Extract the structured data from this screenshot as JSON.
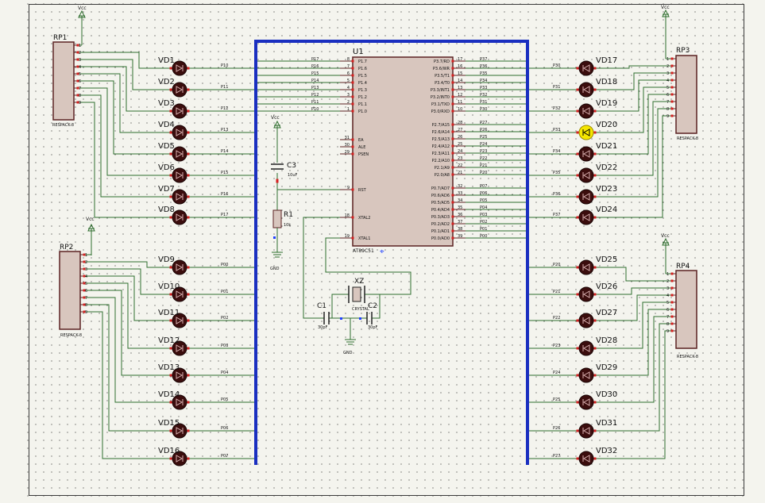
{
  "sheet": {
    "background": "#f4f4ee",
    "grid_color": "#1a1a1a",
    "border_color": "#3a3a3a",
    "wire_color": "#2e6e2e",
    "bus_color": "#1a2fc0",
    "chip_fill": "#d8c6be",
    "chip_border": "#5b2222",
    "led_off_color": "#3b0d0d",
    "led_on_color": "#f5e600",
    "pin_dot_color": "#d62020",
    "blue_marker_color": "#2040ff"
  },
  "labels": {
    "vcc": "Vcc",
    "gnd": "GND",
    "resistor_pack_value": "RESPACK-8"
  },
  "resistor_packs": [
    {
      "ref": "RP1",
      "pins": [
        "1",
        "2",
        "3",
        "4",
        "5",
        "6",
        "7",
        "8",
        "9"
      ]
    },
    {
      "ref": "RP2",
      "pins": [
        "1",
        "2",
        "3",
        "4",
        "5",
        "6",
        "7",
        "8",
        "9"
      ]
    },
    {
      "ref": "RP3",
      "pins": [
        "1",
        "2",
        "3",
        "4",
        "5",
        "6",
        "7",
        "8",
        "9"
      ]
    },
    {
      "ref": "RP4",
      "pins": [
        "1",
        "2",
        "3",
        "4",
        "5",
        "6",
        "7",
        "8",
        "9"
      ]
    }
  ],
  "leds_left": [
    {
      "ref": "VD1",
      "net": "P10"
    },
    {
      "ref": "VD2",
      "net": "P11"
    },
    {
      "ref": "VD3",
      "net": "P12"
    },
    {
      "ref": "VD4",
      "net": "P13"
    },
    {
      "ref": "VD5",
      "net": "P14"
    },
    {
      "ref": "VD6",
      "net": "P15"
    },
    {
      "ref": "VD7",
      "net": "P16"
    },
    {
      "ref": "VD8",
      "net": "P17"
    },
    {
      "ref": "VD9",
      "net": "P00"
    },
    {
      "ref": "VD10",
      "net": "P01"
    },
    {
      "ref": "VD11",
      "net": "P02"
    },
    {
      "ref": "VD12",
      "net": "P03"
    },
    {
      "ref": "VD13",
      "net": "P04"
    },
    {
      "ref": "VD14",
      "net": "P05"
    },
    {
      "ref": "VD15",
      "net": "P06"
    },
    {
      "ref": "VD16",
      "net": "P07"
    }
  ],
  "leds_right": [
    {
      "ref": "VD17",
      "net": "P30",
      "lit": false
    },
    {
      "ref": "VD18",
      "net": "P31",
      "lit": false
    },
    {
      "ref": "VD19",
      "net": "P32",
      "lit": false
    },
    {
      "ref": "VD20",
      "net": "P33",
      "lit": true
    },
    {
      "ref": "VD21",
      "net": "P34",
      "lit": false
    },
    {
      "ref": "VD22",
      "net": "P35",
      "lit": false
    },
    {
      "ref": "VD23",
      "net": "P36",
      "lit": false
    },
    {
      "ref": "VD24",
      "net": "P37",
      "lit": false
    },
    {
      "ref": "VD25",
      "net": "P20",
      "lit": false
    },
    {
      "ref": "VD26",
      "net": "P21",
      "lit": false
    },
    {
      "ref": "VD27",
      "net": "P22",
      "lit": false
    },
    {
      "ref": "VD28",
      "net": "P23",
      "lit": false
    },
    {
      "ref": "VD29",
      "net": "P24",
      "lit": false
    },
    {
      "ref": "VD30",
      "net": "P25",
      "lit": false
    },
    {
      "ref": "VD31",
      "net": "P26",
      "lit": false
    },
    {
      "ref": "VD32",
      "net": "P27",
      "lit": false
    }
  ],
  "mcu": {
    "ref": "U1",
    "part": "AT89C51",
    "left_pins": [
      {
        "num": "8",
        "name": "P1.7",
        "net": "P17"
      },
      {
        "num": "7",
        "name": "P1.6",
        "net": "P16"
      },
      {
        "num": "6",
        "name": "P1.5",
        "net": "P15"
      },
      {
        "num": "5",
        "name": "P1.4",
        "net": "P14"
      },
      {
        "num": "4",
        "name": "P1.3",
        "net": "P13"
      },
      {
        "num": "3",
        "name": "P1.2",
        "net": "P12"
      },
      {
        "num": "2",
        "name": "P1.1",
        "net": "P11"
      },
      {
        "num": "1",
        "name": "P1.0",
        "net": "P10"
      },
      {
        "num": "31",
        "name": "EA",
        "net": ""
      },
      {
        "num": "30",
        "name": "ALE",
        "net": ""
      },
      {
        "num": "29",
        "name": "PSEN",
        "net": ""
      },
      {
        "num": "9",
        "name": "RST",
        "net": ""
      },
      {
        "num": "18",
        "name": "XTAL2",
        "net": ""
      },
      {
        "num": "19",
        "name": "XTAL1",
        "net": ""
      }
    ],
    "right_pins": [
      {
        "num": "17",
        "name": "P3.7/RD",
        "net": "P37"
      },
      {
        "num": "16",
        "name": "P3.6/WR",
        "net": "P36"
      },
      {
        "num": "15",
        "name": "P3.5/T1",
        "net": "P35"
      },
      {
        "num": "14",
        "name": "P3.4/T0",
        "net": "P34"
      },
      {
        "num": "13",
        "name": "P3.3/INT1",
        "net": "P33"
      },
      {
        "num": "12",
        "name": "P3.2/INT0",
        "net": "P32"
      },
      {
        "num": "11",
        "name": "P3.1/TXD",
        "net": "P31"
      },
      {
        "num": "10",
        "name": "P3.0/RXD",
        "net": "P30"
      },
      {
        "num": "28",
        "name": "P2.7/A15",
        "net": "P27"
      },
      {
        "num": "27",
        "name": "P2.6/A14",
        "net": "P26"
      },
      {
        "num": "26",
        "name": "P2.5/A13",
        "net": "P25"
      },
      {
        "num": "25",
        "name": "P2.4/A12",
        "net": "P24"
      },
      {
        "num": "24",
        "name": "P2.3/A11",
        "net": "P23"
      },
      {
        "num": "23",
        "name": "P2.2/A10",
        "net": "P22"
      },
      {
        "num": "22",
        "name": "P2.1/A9",
        "net": "P21"
      },
      {
        "num": "21",
        "name": "P2.0/A8",
        "net": "P20"
      },
      {
        "num": "32",
        "name": "P0.7/AD7",
        "net": "P07"
      },
      {
        "num": "33",
        "name": "P0.6/AD6",
        "net": "P06"
      },
      {
        "num": "34",
        "name": "P0.5/AD5",
        "net": "P05"
      },
      {
        "num": "35",
        "name": "P0.4/AD4",
        "net": "P04"
      },
      {
        "num": "36",
        "name": "P0.3/AD3",
        "net": "P03"
      },
      {
        "num": "37",
        "name": "P0.2/AD2",
        "net": "P02"
      },
      {
        "num": "38",
        "name": "P0.1/AD1",
        "net": "P01"
      },
      {
        "num": "39",
        "name": "P0.0/AD0",
        "net": "P00"
      }
    ]
  },
  "passives": {
    "c3": {
      "ref": "C3",
      "value": "10uF"
    },
    "r1": {
      "ref": "R1",
      "value": "10k"
    },
    "c1": {
      "ref": "C1",
      "value": "30pF"
    },
    "c2": {
      "ref": "C2",
      "value": "30pF"
    },
    "xtal": {
      "ref": "XZ",
      "value": "CRYSTAL"
    }
  }
}
